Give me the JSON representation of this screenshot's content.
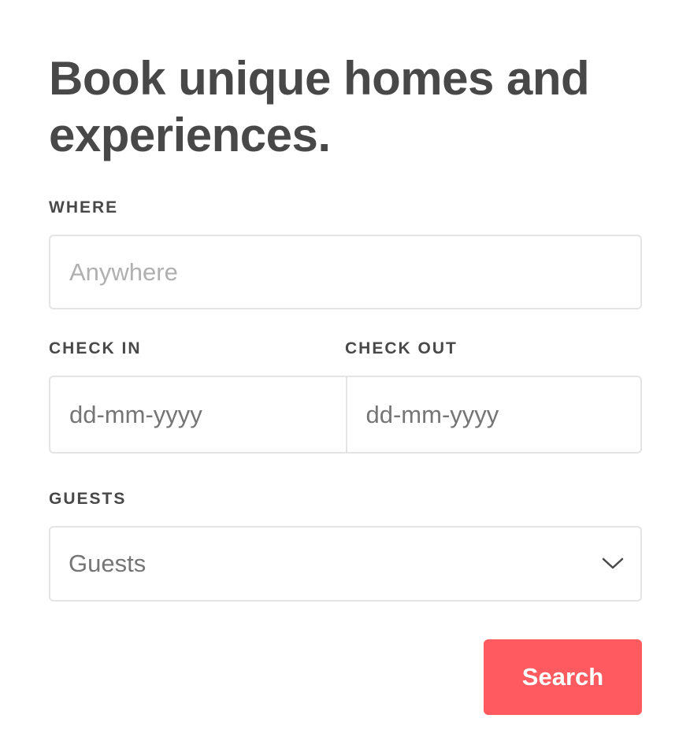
{
  "heading": "Book unique homes and experiences.",
  "where": {
    "label": "WHERE",
    "placeholder": "Anywhere"
  },
  "check_in": {
    "label": "CHECK IN",
    "placeholder": "dd-mm-yyyy"
  },
  "check_out": {
    "label": "CHECK OUT",
    "placeholder": "dd-mm-yyyy"
  },
  "guests": {
    "label": "GUESTS",
    "selected": "Guests",
    "icon": "chevron-down-icon"
  },
  "search_button": {
    "label": "Search",
    "color": "#ff5a5f"
  }
}
